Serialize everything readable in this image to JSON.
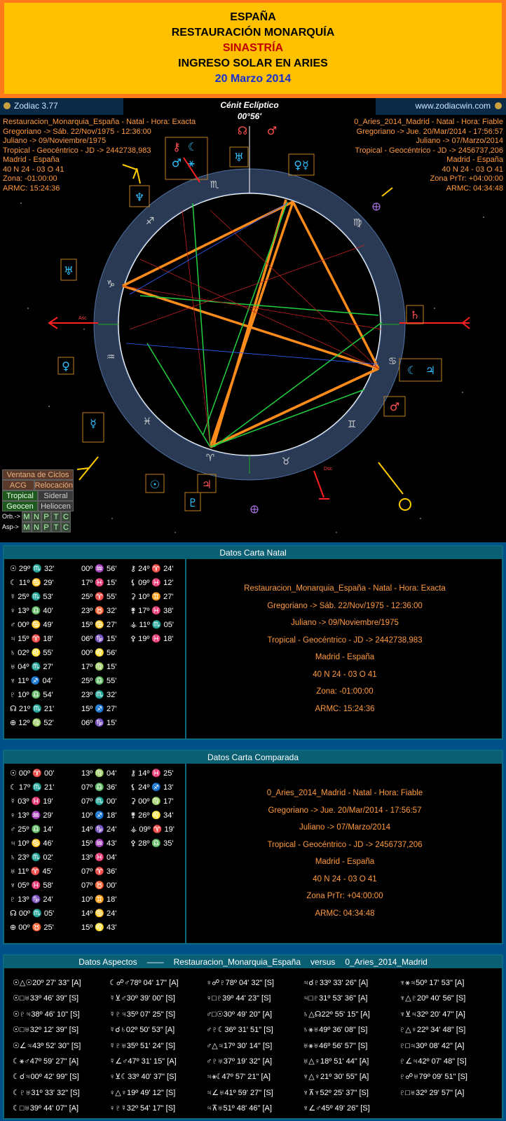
{
  "banner": {
    "line1": "ESPAÑA",
    "line2": "RESTAURACIÓN MONARQUÍA",
    "line3": "SINASTRÍA",
    "line4": "INGRESO SOLAR EN ARIES",
    "line5": "20 Marzo 2014"
  },
  "app": {
    "title": "Zodiac 3.77",
    "url": "www.zodiacwin.com",
    "cenit_label": "Cénit Eclíptico",
    "cenit_value": "00°56'"
  },
  "natal_header": [
    "Restauracion_Monarquia_España - Natal - Hora: Exacta",
    "Gregoriano -> Sáb. 22/Nov/1975 - 12:36:00",
    "Juliano -> 09/Noviembre/1975",
    "Tropical - Geocéntrico - JD -> 2442738,983",
    "Madrid - España",
    "40 N 24 - 03 O 41",
    "Zona: -01:00:00",
    "ARMC: 15:24:36"
  ],
  "comp_header": [
    "0_Aries_2014_Madrid - Natal - Hora: Fiable",
    "Gregoriano -> Jue. 20/Mar/2014 - 17:56:57",
    "Juliano -> 07/Marzo/2014",
    "Tropical - Geocéntrico - JD -> 2456737,206",
    "Madrid - España",
    "40 N 24 - 03 O 41",
    "Zona PrTr: +04:00:00",
    "ARMC: 04:34:48"
  ],
  "wheel_labels": {
    "asc": "Asc",
    "dsc": "Dsc"
  },
  "side_buttons": {
    "ventana": "Ventana de Ciclos",
    "acg": "ACG",
    "relocacion": "Relocación",
    "tropical": "Tropical",
    "sideral": "Sideral",
    "geocen": "Geocen",
    "heliocen": "Heliocen",
    "orb": "Orb.->",
    "asp": "Asp->",
    "m": "M",
    "n": "N",
    "p": "P",
    "t": "T",
    "c": "C"
  },
  "natal": {
    "title": "Datos Carta Natal",
    "col1": [
      "☉ 29º ♏ 32'",
      "☾ 11º ♋ 29'",
      "☿ 25º ♏ 53'",
      "♀ 13º ♎ 40'",
      "♂ 00º ♋ 49'",
      "♃ 15º ♈ 18'",
      "♄ 02º ♌ 55'",
      "♅ 04º ♏ 27'",
      "♆ 11º ♐ 04'",
      "♇ 10º ♎ 54'",
      "☊ 21º ♏ 21'",
      "⊕ 12º ♍ 52'"
    ],
    "col2": [
      "00º ♒ 56'",
      "17º ♓ 15'",
      "25º ♈ 55'",
      "23º ♉ 32'",
      "15º ♋ 27'",
      "06º ♑ 15'",
      "00º ♌ 56'",
      "17º ♍ 15'",
      "25º ♎ 55'",
      "23º ♏ 32'",
      "15º ♐ 27'",
      "06º ♑ 15'"
    ],
    "col3": [
      "⚷ 24º ♈ 24'",
      "⚸ 09º ♓ 12'",
      "⚳ 10º ♊ 27'",
      "⚵ 17º ♓ 38'",
      "⚶ 11º ♏ 05'",
      "⚴ 19º ♓ 18'"
    ]
  },
  "comp": {
    "title": "Datos Carta Comparada",
    "col1": [
      "☉ 00º ♈ 00'",
      "☾ 17º ♏ 21'",
      "☿ 03º ♓ 19'",
      "♀ 13º ♒ 29'",
      "♂ 25º ♎ 14'",
      "♃ 10º ♋ 46'",
      "♄ 23º ♏ 02'",
      "♅ 11º ♈ 45'",
      "♆ 05º ♓ 58'",
      "♇ 13º ♑ 24'",
      "☊ 00º ♏ 05'",
      "⊕ 00º ♉ 25'"
    ],
    "col2": [
      "13º ♍ 04'",
      "07º ♎ 36'",
      "07º ♏ 00'",
      "10º ♐ 18'",
      "14º ♑ 24'",
      "15º ♒ 43'",
      "13º ♓ 04'",
      "07º ♈ 36'",
      "07º ♉ 00'",
      "10º ♊ 18'",
      "14º ♋ 24'",
      "15º ♌ 43'"
    ],
    "col3": [
      "⚷ 14º ♓ 25'",
      "⚸ 24º ♐ 13'",
      "⚳ 00º ♍ 17'",
      "⚵ 26º ♌ 34'",
      "⚶ 09º ♈ 19'",
      "⚴ 28º ♎ 35'"
    ]
  },
  "aspects": {
    "title_left": "Datos Aspectos",
    "title_sep": "——",
    "title_a": "Restauracion_Monarquia_España",
    "title_vs": "versus",
    "title_b": "0_Aries_2014_Madrid",
    "cells": [
      "☉△☉20º 27' 33\" [A]",
      "☾☍♂78º 04' 17\" [A]",
      "♀☍♇78º 04' 32\" [S]",
      "♃☌♇33º 33' 26\" [A]",
      "♆⚹♃50º 17' 53\" [A]",
      "☉□♅33º 46' 39\" [S]",
      "☿⊻♂30º 39' 00\" [S]",
      "♀□♇39º 44' 23\" [S]",
      "♃□♇31º 53' 36\" [A]",
      "♆△♇20º 40' 56\" [S]",
      "☉♇♃38º 46' 10\" [S]",
      "☿♇♃35º 07' 25\" [S]",
      "♂□☉30º 49' 20\" [A]",
      "♄△☊22º 55' 15\" [A]",
      "♆⊻♃32º 20' 47\" [A]",
      "☉□♅32º 12' 39\" [S]",
      "☿☌♄02º 50' 53\" [A]",
      "♂♇☾36º 31' 51\" [S]",
      "♄⚹♅49º 36' 08\" [S]",
      "♇△♀22º 34' 48\" [S]",
      "☉∠♃43º 52' 30\" [S]",
      "☿♇♅35º 51' 24\" [S]",
      "♂△♃17º 30' 14\" [S]",
      "♅⚹♅46º 56' 57\" [S]",
      "♇□♃30º 08' 42\" [A]",
      "☾⚹♂47º 59' 27\" [A]",
      "☿∠♂47º 31' 15\" [A]",
      "♂♇♅37º 19' 32\" [A]",
      "♅△♀18º 51' 44\" [A]",
      "♇∠♃42º 07' 48\" [S]",
      "☾☌♃00º 42' 99\" [S]",
      "♀⊻☾33º 40' 37\" [S]",
      "♃⚹☾47º 57' 21\" [A]",
      "♆△♀21º 30' 55\" [A]",
      "♇☍♅79º 09' 51\" [S]",
      "☾♇♅31º 33' 32\" [S]",
      "♀△♀19º 49' 12\" [S]",
      "♃∠♅41º 59' 27\" [S]",
      "♆⊼♆52º 25' 37\" [S]",
      "♇□♅32º 29' 57\" [A]",
      "☾□♅39º 44' 07\" [A]",
      "♀♇☿32º 54' 17\" [S]",
      "♃⊼♅51º 48' 46\" [A]",
      "♆∠♂45º 49' 26\" [S]",
      ""
    ]
  }
}
